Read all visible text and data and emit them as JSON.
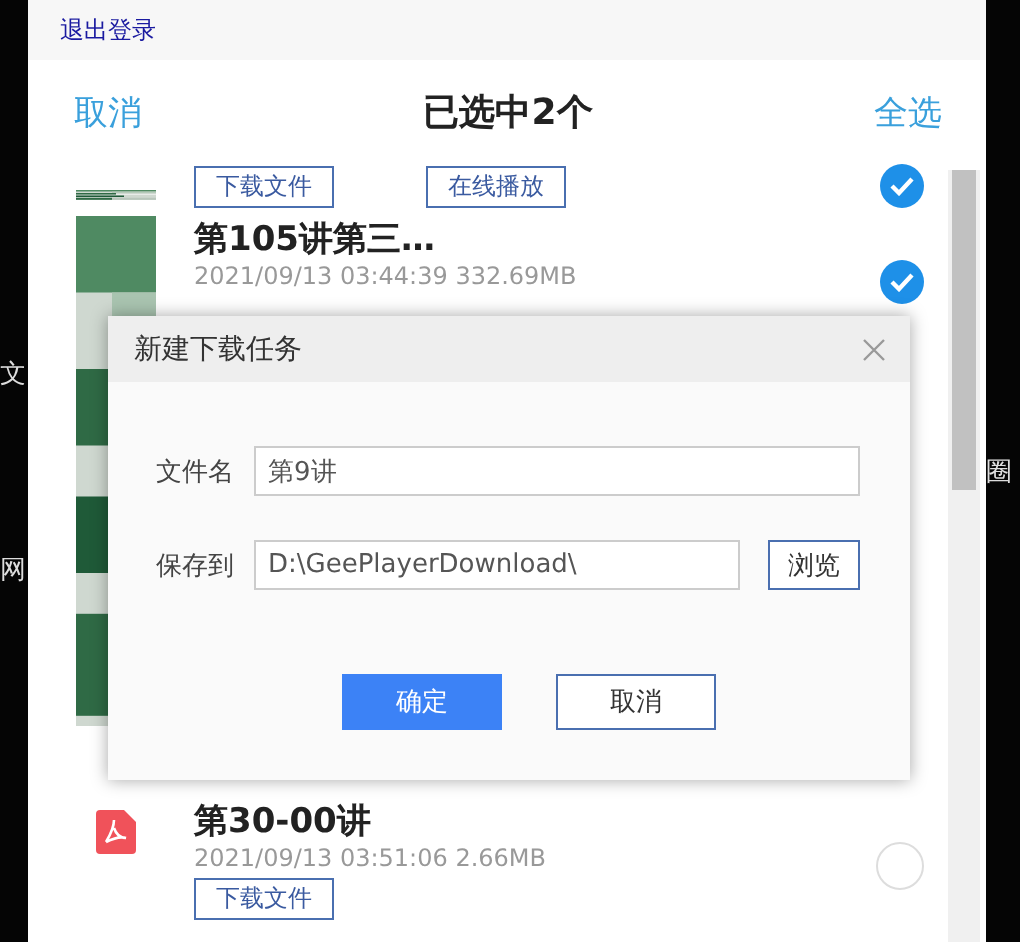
{
  "account": {
    "logout": "退出登录"
  },
  "header": {
    "cancel": "取消",
    "title": "已选中2个",
    "select_all": "全选"
  },
  "side_left": [
    "文",
    "网"
  ],
  "side_right": [
    "圈"
  ],
  "items": [
    {
      "kind": "video",
      "selected": true,
      "actions": [
        "下载文件",
        "在线播放"
      ]
    },
    {
      "kind": "video",
      "title": "第105讲第三…",
      "meta": "2021/09/13 03:44:39 332.69MB",
      "selected": true
    },
    {
      "kind": "pdf",
      "title": "第30-00讲",
      "meta": "2021/09/13 03:51:06 2.66MB",
      "selected": false,
      "actions": [
        "下载文件"
      ]
    }
  ],
  "dialog": {
    "title": "新建下载任务",
    "fields": [
      {
        "label": "文件名",
        "value": "第9讲"
      },
      {
        "label": "保存到",
        "value": "D:\\GeePlayerDownload\\",
        "browse": "浏览"
      }
    ],
    "ok": "确定",
    "cancel": "取消"
  }
}
